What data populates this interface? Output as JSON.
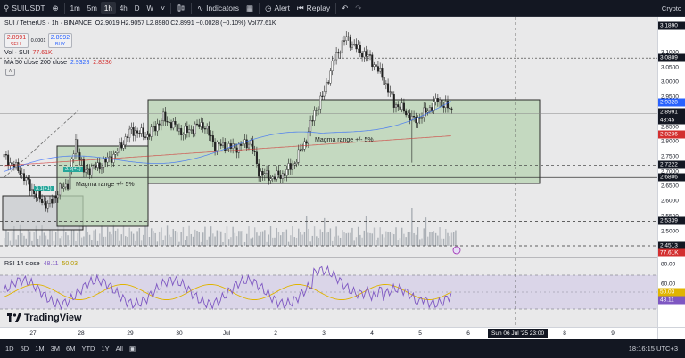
{
  "toolbar": {
    "symbol": "SUIUSDT",
    "timeframes": [
      "1m",
      "5m",
      "1h",
      "4h",
      "D",
      "W"
    ],
    "active_timeframe": "1h",
    "indicators_label": "Indicators",
    "alert_label": "Alert",
    "replay_label": "Replay",
    "right_label": "Crypto"
  },
  "chart": {
    "title": "SUI / TetherUS · 1h · BINANCE",
    "ohlc": "O2.9019 H2.9057 L2.8980 C2.8991 −0.0028 (−0.10%) Vol77.61K",
    "sell_price": "2.8991",
    "sell_label": "SELL",
    "spread": "0.0001",
    "buy_price": "2.8992",
    "buy_label": "BUY",
    "vol_label": "Vol · SUI",
    "vol_value": "77.61K",
    "ma_label": "MA 50 close 200 close",
    "ma_values": [
      "2.9328",
      "2.8236"
    ],
    "annotations": [
      "Magma range +/- 5%",
      "Magma range +/- 5%"
    ],
    "box_tags": [
      "3.5(+1)",
      "3.1(+1)"
    ]
  },
  "rsi": {
    "label": "RSI 14 close",
    "values": [
      "48.11",
      "50.03"
    ],
    "axis_ticks": [
      "80.00",
      "60.00",
      "40.00"
    ],
    "tags": [
      "50.03",
      "48.11"
    ]
  },
  "price_axis": {
    "ticks": [
      "3.1890",
      "3.1000",
      "3.0500",
      "3.0000",
      "2.9500",
      "2.9000",
      "2.8500",
      "2.8000",
      "2.7500",
      "2.7000",
      "2.6500",
      "2.6000",
      "2.5500",
      "2.5000",
      "2.4500"
    ],
    "tags": [
      {
        "text": "3.1890",
        "bg": "#131722",
        "fg": "#ffffff"
      },
      {
        "text": "3.0809",
        "bg": "#131722",
        "fg": "#ffffff"
      },
      {
        "text": "2.9328",
        "bg": "#2962ff",
        "fg": "#ffffff"
      },
      {
        "text": "2.8991",
        "bg": "#131722",
        "fg": "#ffffff"
      },
      {
        "text": "43:45",
        "bg": "#131722",
        "fg": "#ffffff"
      },
      {
        "text": "2.8236",
        "bg": "#d32f2f",
        "fg": "#ffffff"
      },
      {
        "text": "2.7222",
        "bg": "#131722",
        "fg": "#ffffff"
      },
      {
        "text": "2.6806",
        "bg": "#131722",
        "fg": "#ffffff"
      },
      {
        "text": "2.5339",
        "bg": "#131722",
        "fg": "#ffffff"
      },
      {
        "text": "2.4513",
        "bg": "#131722",
        "fg": "#ffffff"
      },
      {
        "text": "77.61K",
        "bg": "#d32f2f",
        "fg": "#ffffff"
      }
    ]
  },
  "time_axis": {
    "labels": [
      "27",
      "28",
      "29",
      "30",
      "Jul",
      "2",
      "3",
      "4",
      "5",
      "6",
      "7",
      "8",
      "9"
    ],
    "crosshair_tag": "Sun 06 Jul '25  23:00"
  },
  "bottom": {
    "ranges": [
      "1D",
      "5D",
      "1M",
      "3M",
      "6M",
      "YTD",
      "1Y",
      "All"
    ],
    "clock": "18:16:15 UTC+3"
  },
  "brand": "TradingView"
}
